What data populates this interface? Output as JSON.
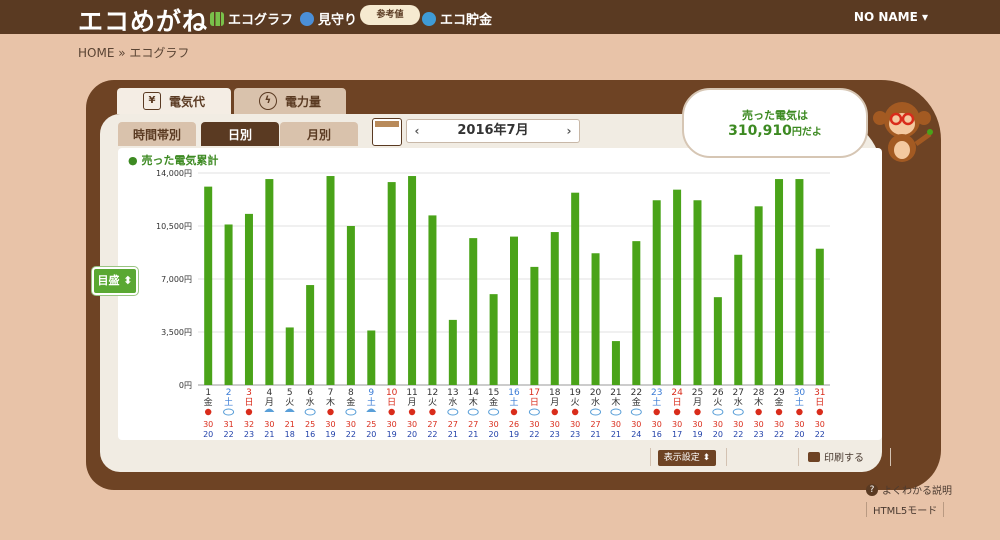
{
  "header": {
    "logo": "エコめがね",
    "nav": [
      {
        "label": "エコグラフ",
        "icon": "bar-graph-icon"
      },
      {
        "label": "見守り",
        "icon": "binoculars-icon"
      },
      {
        "label": "エコ貯金",
        "icon": "piggy-bank-icon"
      }
    ],
    "badge": "参考値",
    "user": "NO NAME ▾"
  },
  "breadcrumb": "HOME » エコグラフ",
  "tabs": {
    "fee": "電気代",
    "energy": "電力量"
  },
  "subtabs": {
    "time": "時間帯別",
    "day": "日別",
    "month": "月別"
  },
  "period": {
    "label": "2016年7月",
    "prev": "‹",
    "next": "›"
  },
  "summary": {
    "title": "売った電気は",
    "value": "310,910",
    "unit": "円だよ"
  },
  "unit_button": "目盛 ⬍",
  "display_button": "表示設定 ⬍",
  "print_button": "印刷する",
  "help_link": "よくわかる説明",
  "html5_link": "HTML5モード",
  "colors": {
    "bar": "#4aa319",
    "brown": "#5a3a22",
    "sun": "#d92c1b",
    "cloud": "#5a9fd8",
    "max": "#d92c1b",
    "min": "#1f3fa8"
  },
  "chart_data": {
    "type": "bar",
    "title": "売った電気累計",
    "ylim": [
      0,
      14000
    ],
    "yticks": [
      "0円",
      "3,500円",
      "7,000円",
      "10,500円",
      "14,000円"
    ],
    "categories": [
      "1",
      "2",
      "3",
      "4",
      "5",
      "6",
      "7",
      "8",
      "9",
      "10",
      "11",
      "12",
      "13",
      "14",
      "15",
      "16",
      "17",
      "18",
      "19",
      "20",
      "21",
      "22",
      "23",
      "24",
      "25",
      "26",
      "27",
      "28",
      "29",
      "30",
      "31"
    ],
    "weekdays": [
      "金",
      "土",
      "日",
      "月",
      "火",
      "水",
      "木",
      "金",
      "土",
      "日",
      "月",
      "火",
      "水",
      "木",
      "金",
      "土",
      "日",
      "月",
      "火",
      "水",
      "木",
      "金",
      "土",
      "日",
      "月",
      "火",
      "水",
      "木",
      "金",
      "土",
      "日"
    ],
    "weather": [
      "sun",
      "cloud",
      "sun",
      "umbrella",
      "umbrella",
      "cloud",
      "sun",
      "cloud",
      "umbrella",
      "sun",
      "sun",
      "sun",
      "cloud",
      "cloud",
      "cloud",
      "sun",
      "cloud",
      "sun",
      "sun",
      "cloud",
      "cloud",
      "cloud",
      "sun",
      "sun",
      "sun",
      "cloud",
      "cloud",
      "sun",
      "sun",
      "sun",
      "sun"
    ],
    "max_temp": [
      "30",
      "31",
      "32",
      "30",
      "21",
      "25",
      "30",
      "30",
      "25",
      "30",
      "30",
      "27",
      "27",
      "27",
      "30",
      "26",
      "30",
      "30",
      "30",
      "27",
      "30",
      "30",
      "30",
      "30",
      "30",
      "30",
      "30",
      "30",
      "30",
      "30",
      "30"
    ],
    "min_temp": [
      "20",
      "22",
      "23",
      "21",
      "18",
      "16",
      "19",
      "22",
      "20",
      "19",
      "20",
      "22",
      "21",
      "21",
      "20",
      "19",
      "22",
      "23",
      "23",
      "21",
      "21",
      "24",
      "16",
      "17",
      "19",
      "20",
      "22",
      "23",
      "22",
      "20",
      "22"
    ],
    "values": [
      13100,
      10600,
      11300,
      13600,
      3800,
      6600,
      13800,
      10500,
      3600,
      13400,
      13800,
      11200,
      4300,
      9700,
      6000,
      9800,
      7800,
      10100,
      12700,
      8700,
      2900,
      9500,
      12200,
      12900,
      12200,
      5800,
      8600,
      11800,
      13600,
      13600,
      9000
    ]
  }
}
